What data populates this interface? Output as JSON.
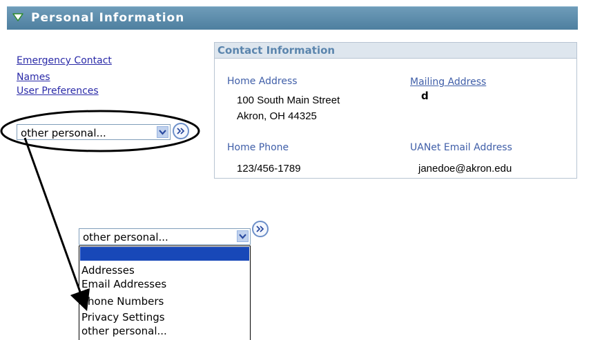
{
  "header": {
    "title": "Personal Information"
  },
  "left_links": [
    "Emergency Contact",
    "Names",
    "User Preferences"
  ],
  "dropdown": {
    "selected": "other personal...",
    "go_icon": "double-chevron-right-icon"
  },
  "contact": {
    "heading": "Contact Information",
    "home_address_label": "Home Address",
    "home_address_line1": "100 South Main Street",
    "home_address_line2": "Akron, OH 44325",
    "mailing_address_label": "Mailing Address",
    "mailing_address_value": "d",
    "home_phone_label": "Home Phone",
    "home_phone_value": "123/456-1789",
    "email_label": "UANet Email Address",
    "email_value": "janedoe@akron.edu"
  },
  "expanded_dropdown": {
    "selected": "other personal...",
    "options": [
      "",
      "Addresses",
      "Email Addresses",
      "Phone Numbers",
      "Privacy Settings",
      "other personal..."
    ],
    "highlighted_index": 0
  },
  "colors": {
    "header": "#5a8aab",
    "link": "#2a2aa8",
    "highlight": "#1848b8",
    "label": "#3f5ea8"
  }
}
